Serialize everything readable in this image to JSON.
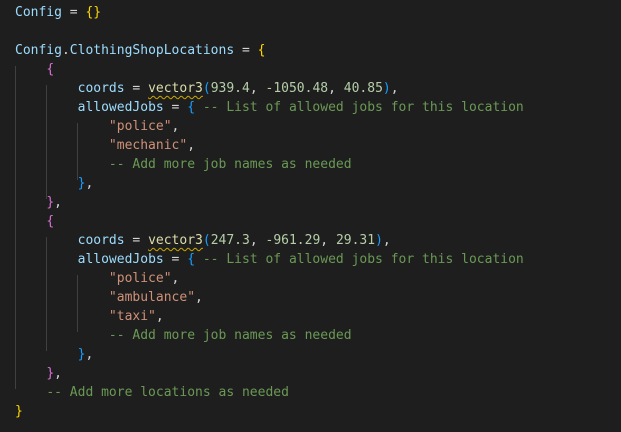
{
  "editor": {
    "lines": [
      [
        {
          "t": "Config",
          "c": "var"
        },
        {
          "t": " = ",
          "c": "op"
        },
        {
          "t": "{}",
          "c": "b1"
        }
      ],
      [],
      [
        {
          "t": "Config",
          "c": "var"
        },
        {
          "t": ".",
          "c": "op"
        },
        {
          "t": "ClothingShopLocations",
          "c": "var"
        },
        {
          "t": " = ",
          "c": "op"
        },
        {
          "t": "{",
          "c": "b1"
        }
      ],
      [
        {
          "t": "    "
        },
        {
          "t": "{",
          "c": "b2"
        }
      ],
      [
        {
          "t": "        "
        },
        {
          "t": "coords",
          "c": "var"
        },
        {
          "t": " = ",
          "c": "op"
        },
        {
          "t": "vector3",
          "c": "fn",
          "sq": true
        },
        {
          "t": "(",
          "c": "b3"
        },
        {
          "t": "939.4",
          "c": "num"
        },
        {
          "t": ", ",
          "c": "op"
        },
        {
          "t": "-1050.48",
          "c": "num"
        },
        {
          "t": ", ",
          "c": "op"
        },
        {
          "t": "40.85",
          "c": "num"
        },
        {
          "t": ")",
          "c": "b3"
        },
        {
          "t": ",",
          "c": "op"
        }
      ],
      [
        {
          "t": "        "
        },
        {
          "t": "allowedJobs",
          "c": "var"
        },
        {
          "t": " = ",
          "c": "op"
        },
        {
          "t": "{",
          "c": "b3"
        },
        {
          "t": " "
        },
        {
          "t": "-- List of allowed jobs for this location",
          "c": "com"
        }
      ],
      [
        {
          "t": "            "
        },
        {
          "t": "\"police\"",
          "c": "str"
        },
        {
          "t": ",",
          "c": "op"
        }
      ],
      [
        {
          "t": "            "
        },
        {
          "t": "\"mechanic\"",
          "c": "str"
        },
        {
          "t": ",",
          "c": "op"
        }
      ],
      [
        {
          "t": "            "
        },
        {
          "t": "-- Add more job names as needed",
          "c": "com"
        }
      ],
      [
        {
          "t": "        "
        },
        {
          "t": "}",
          "c": "b3"
        },
        {
          "t": ",",
          "c": "op"
        }
      ],
      [
        {
          "t": "    "
        },
        {
          "t": "}",
          "c": "b2"
        },
        {
          "t": ",",
          "c": "op"
        }
      ],
      [
        {
          "t": "    "
        },
        {
          "t": "{",
          "c": "b2"
        }
      ],
      [
        {
          "t": "        "
        },
        {
          "t": "coords",
          "c": "var"
        },
        {
          "t": " = ",
          "c": "op"
        },
        {
          "t": "vector3",
          "c": "fn",
          "sq": true
        },
        {
          "t": "(",
          "c": "b3"
        },
        {
          "t": "247.3",
          "c": "num"
        },
        {
          "t": ", ",
          "c": "op"
        },
        {
          "t": "-961.29",
          "c": "num"
        },
        {
          "t": ", ",
          "c": "op"
        },
        {
          "t": "29.31",
          "c": "num"
        },
        {
          "t": ")",
          "c": "b3"
        },
        {
          "t": ",",
          "c": "op"
        }
      ],
      [
        {
          "t": "        "
        },
        {
          "t": "allowedJobs",
          "c": "var"
        },
        {
          "t": " = ",
          "c": "op"
        },
        {
          "t": "{",
          "c": "b3"
        },
        {
          "t": " "
        },
        {
          "t": "-- List of allowed jobs for this location",
          "c": "com"
        }
      ],
      [
        {
          "t": "            "
        },
        {
          "t": "\"police\"",
          "c": "str"
        },
        {
          "t": ",",
          "c": "op"
        }
      ],
      [
        {
          "t": "            "
        },
        {
          "t": "\"ambulance\"",
          "c": "str"
        },
        {
          "t": ",",
          "c": "op"
        }
      ],
      [
        {
          "t": "            "
        },
        {
          "t": "\"taxi\"",
          "c": "str"
        },
        {
          "t": ",",
          "c": "op"
        }
      ],
      [
        {
          "t": "            "
        },
        {
          "t": "-- Add more job names as needed",
          "c": "com"
        }
      ],
      [
        {
          "t": "        "
        },
        {
          "t": "}",
          "c": "b3"
        },
        {
          "t": ",",
          "c": "op"
        }
      ],
      [
        {
          "t": "    "
        },
        {
          "t": "}",
          "c": "b2"
        },
        {
          "t": ",",
          "c": "op"
        }
      ],
      [
        {
          "t": "    "
        },
        {
          "t": "-- Add more locations as needed",
          "c": "com"
        }
      ],
      [
        {
          "t": "}",
          "c": "b1"
        }
      ]
    ]
  },
  "theme": {
    "background": "#1e1e1e",
    "variable": "#9cdcfe",
    "function": "#dcdcaa",
    "number": "#b5cea8",
    "string": "#ce9178",
    "comment": "#6a9955",
    "bracket_level1": "#ffd700",
    "bracket_level2": "#da70d6",
    "bracket_level3": "#179fff",
    "warning_squiggle": "#cca700"
  }
}
